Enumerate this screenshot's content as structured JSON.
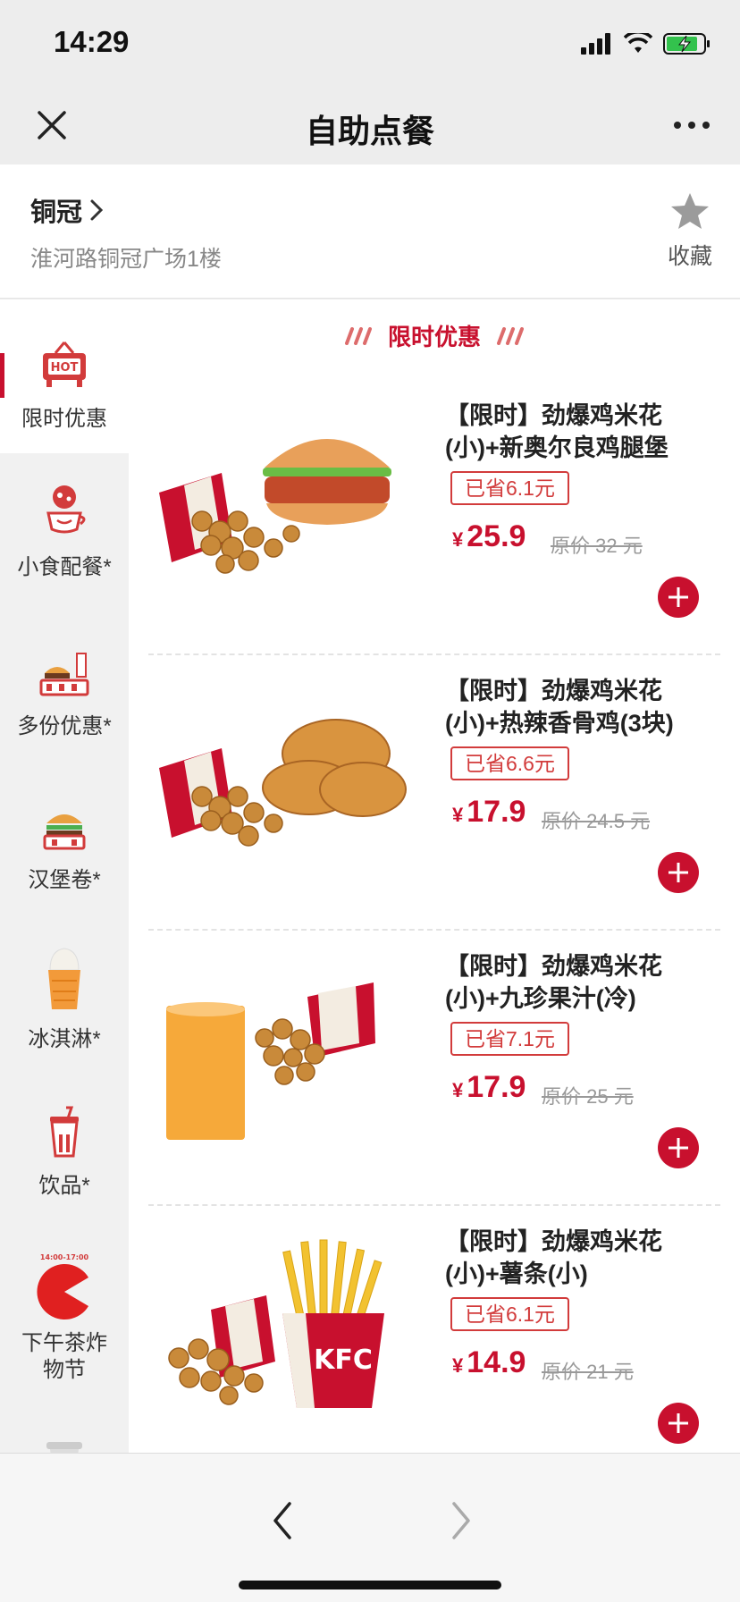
{
  "status": {
    "time": "14:29"
  },
  "nav": {
    "title": "自助点餐"
  },
  "store": {
    "name": "铜冠",
    "address": "淮河路铜冠广场1楼",
    "favorite_label": "收藏"
  },
  "sidebar": {
    "items": [
      {
        "label": "限时优惠",
        "icon": "hot-sign-icon"
      },
      {
        "label": "小食配餐*",
        "icon": "snack-cup-icon"
      },
      {
        "label": "多份优惠*",
        "icon": "meal-bundle-icon"
      },
      {
        "label": "汉堡卷*",
        "icon": "burger-icon"
      },
      {
        "label": "冰淇淋*",
        "icon": "ice-cream-icon"
      },
      {
        "label": "饮品*",
        "icon": "drink-cup-icon"
      },
      {
        "label": "下午茶炸物节",
        "icon": "afternoon-tea-icon",
        "badge": "14:00-17:00"
      }
    ]
  },
  "section": {
    "title": "限时优惠"
  },
  "items": [
    {
      "name": "【限时】劲爆鸡米花(小)+新奥尔良鸡腿堡",
      "saved": "已省6.1元",
      "currency": "¥",
      "price": "25.9",
      "original": "原价 32 元"
    },
    {
      "name": "【限时】劲爆鸡米花(小)+热辣香骨鸡(3块)",
      "saved": "已省6.6元",
      "currency": "¥",
      "price": "17.9",
      "original": "原价 24.5 元"
    },
    {
      "name": "【限时】劲爆鸡米花(小)+九珍果汁(冷)",
      "saved": "已省7.1元",
      "currency": "¥",
      "price": "17.9",
      "original": "原价 25 元"
    },
    {
      "name": "【限时】劲爆鸡米花(小)+薯条(小)",
      "saved": "已省6.1元",
      "currency": "¥",
      "price": "14.9",
      "original": "原价 21 元"
    }
  ],
  "colors": {
    "accent": "#c8102e",
    "background": "#ededed"
  }
}
